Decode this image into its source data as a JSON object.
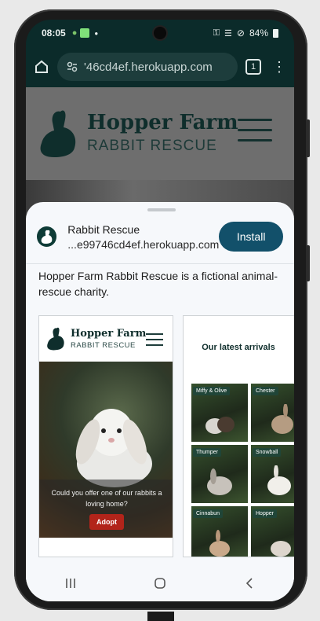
{
  "status": {
    "time": "08:05",
    "battery": "84%"
  },
  "browser": {
    "url": "'46cd4ef.herokuapp.com",
    "tab_count": "1"
  },
  "site": {
    "title": "Hopper Farm",
    "subtitle": "RABBIT RESCUE"
  },
  "install_sheet": {
    "app_name": "Rabbit Rescue",
    "app_url": "...e99746cd4ef.herokuapp.com",
    "install_label": "Install",
    "description": "Hopper Farm Rabbit Rescue is a fictional animal-rescue charity."
  },
  "screenshot1": {
    "title": "Hopper Farm",
    "subtitle": "RABBIT RESCUE",
    "hero_text": "Could you offer one of our rabbits a loving home?",
    "adopt_label": "Adopt"
  },
  "screenshot2": {
    "heading": "Our latest arrivals",
    "rabbits": [
      "Miffy & Olive",
      "Chester",
      "Thumper",
      "Snowball",
      "Cinnabun",
      "Hopper"
    ]
  },
  "colors": {
    "brand_dark": "#0f2e2c",
    "install_button": "#12506a",
    "adopt_button": "#b2241a"
  }
}
